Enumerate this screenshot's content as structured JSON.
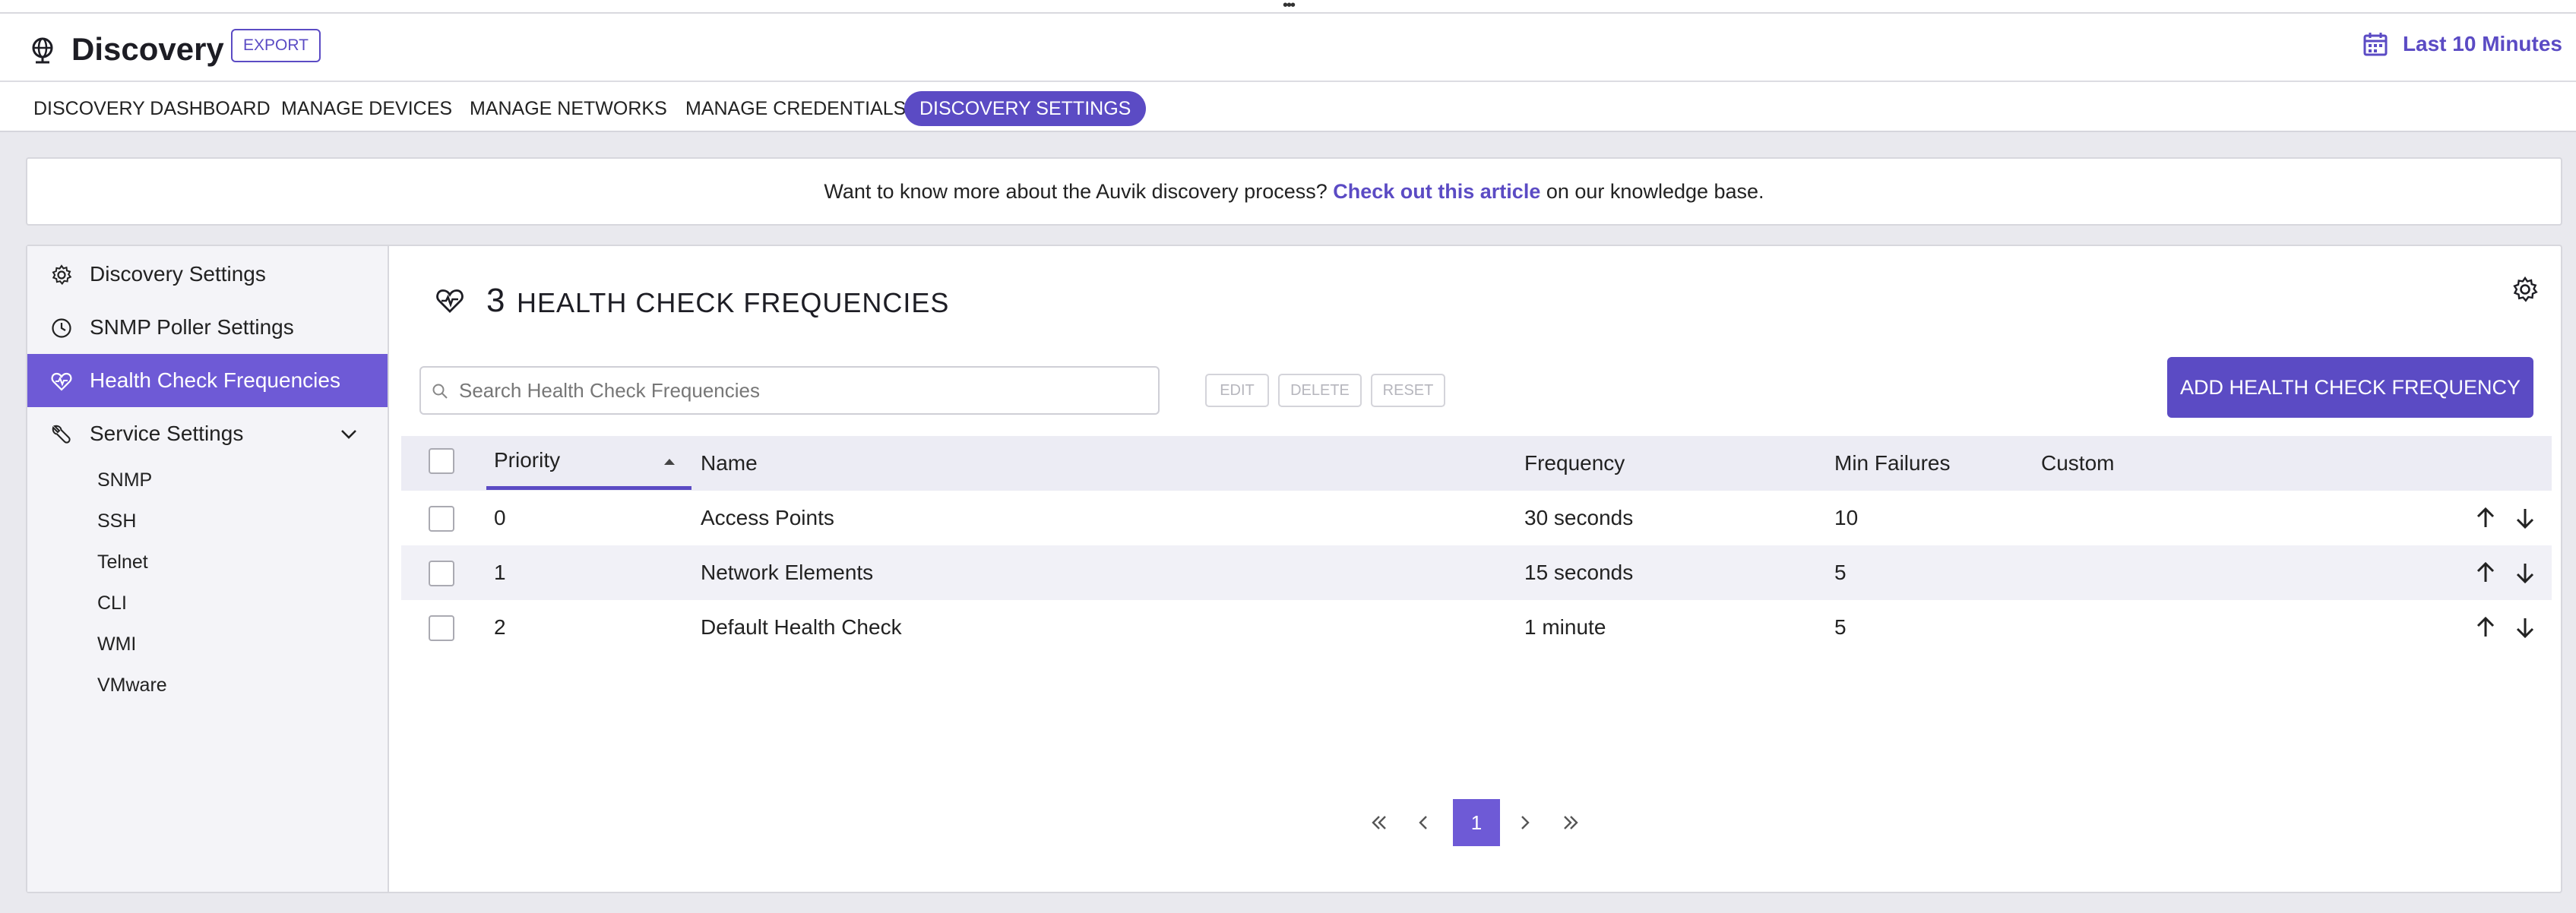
{
  "header": {
    "title": "Discovery",
    "export_label": "EXPORT",
    "time_range": "Last 10 Minutes"
  },
  "tabs": [
    {
      "label": "DISCOVERY DASHBOARD"
    },
    {
      "label": "MANAGE DEVICES"
    },
    {
      "label": "MANAGE NETWORKS"
    },
    {
      "label": "MANAGE CREDENTIALS"
    },
    {
      "label": "DISCOVERY SETTINGS",
      "active": true
    }
  ],
  "banner": {
    "prefix": "Want to know more about the Auvik discovery process?",
    "link": "Check out this article",
    "suffix": "on our knowledge base."
  },
  "sidebar": {
    "items": [
      {
        "label": "Discovery Settings",
        "icon": "gear-icon"
      },
      {
        "label": "SNMP Poller Settings",
        "icon": "clock-icon"
      },
      {
        "label": "Health Check Frequencies",
        "icon": "heart-pulse-icon",
        "active": true
      },
      {
        "label": "Service Settings",
        "icon": "wrench-icon",
        "expanded": true
      }
    ],
    "sub_items": [
      "SNMP",
      "SSH",
      "Telnet",
      "CLI",
      "WMI",
      "VMware"
    ]
  },
  "main": {
    "count": "3",
    "heading": "HEALTH CHECK FREQUENCIES",
    "search_placeholder": "Search Health Check Frequencies",
    "edit_label": "EDIT",
    "delete_label": "DELETE",
    "reset_label": "RESET",
    "add_label": "ADD HEALTH CHECK FREQUENCY"
  },
  "table": {
    "columns": [
      "Priority",
      "Name",
      "Frequency",
      "Min Failures",
      "Custom"
    ],
    "sort_column": "Priority",
    "sort_direction": "ascending",
    "rows": [
      {
        "priority": "0",
        "name": "Access Points",
        "frequency": "30 seconds",
        "min_failures": "10",
        "custom": ""
      },
      {
        "priority": "1",
        "name": "Network Elements",
        "frequency": "15 seconds",
        "min_failures": "5",
        "custom": ""
      },
      {
        "priority": "2",
        "name": "Default Health Check",
        "frequency": "1 minute",
        "min_failures": "5",
        "custom": ""
      }
    ]
  },
  "pagination": {
    "current_page": "1"
  },
  "colors": {
    "accent": "#5b4bc4",
    "sidebar_active": "#6e5ad6"
  }
}
